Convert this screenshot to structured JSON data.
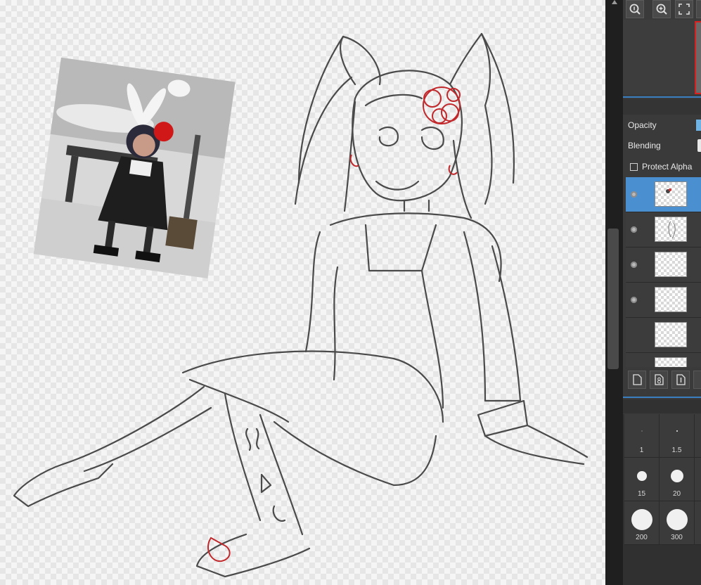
{
  "panel": {
    "toolbar_icons": [
      "zoom-actual-icon",
      "zoom-in-icon",
      "fit-screen-icon"
    ],
    "opacity_label": "Opacity",
    "blending_label": "Blending",
    "protect_alpha_label": "Protect Alpha",
    "layers": [
      {
        "name": "layer-1",
        "visible": true,
        "selected": true
      },
      {
        "name": "layer-2",
        "visible": true,
        "selected": false
      },
      {
        "name": "layer-3",
        "visible": true,
        "selected": false
      },
      {
        "name": "layer-4",
        "visible": true,
        "selected": false
      },
      {
        "name": "layer-5",
        "visible": false,
        "selected": false
      },
      {
        "name": "layer-6",
        "visible": false,
        "selected": false
      }
    ],
    "layer_buttons": [
      "new-layer-icon",
      "new-8bit-layer-icon",
      "new-1bit-layer-icon"
    ],
    "brush_sizes": [
      {
        "label": "1"
      },
      {
        "label": "1.5"
      },
      {
        "label": "15"
      },
      {
        "label": "20"
      },
      {
        "label": "200"
      },
      {
        "label": "300"
      }
    ]
  },
  "colors": {
    "accent": "#3a7fbf",
    "selected_layer": "#4a8fcf",
    "sketch_line": "#4a4a4a",
    "sketch_red": "#c0282b"
  }
}
